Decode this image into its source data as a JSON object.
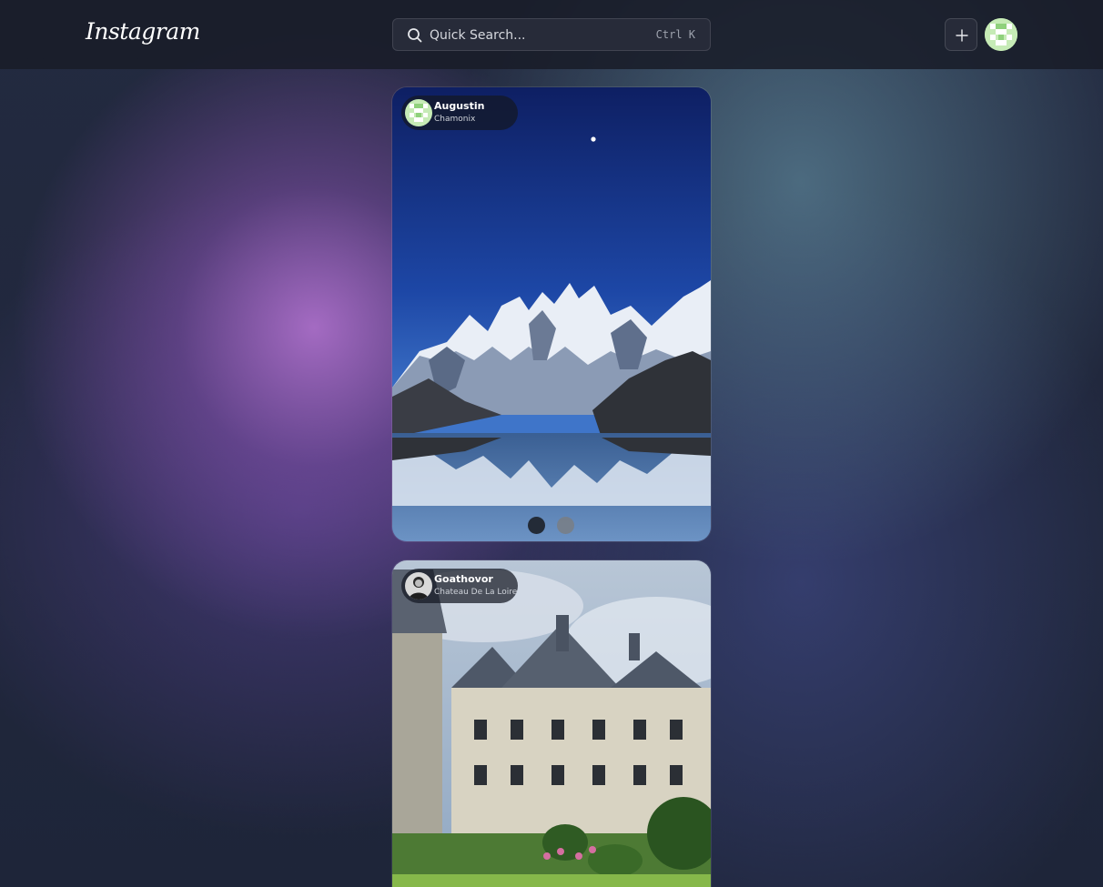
{
  "header": {
    "logo": "Instagram",
    "search": {
      "placeholder": "Quick Search...",
      "shortcut": "Ctrl K"
    },
    "new_post_icon": "plus-icon",
    "avatar_icon": "pixel-avatar"
  },
  "feed": {
    "posts": [
      {
        "username": "Augustin",
        "location": "Chamonix",
        "image": "snowy-mountains-lake-reflection",
        "carousel": {
          "count": 2,
          "active": 1
        }
      },
      {
        "username": "Goathovor",
        "location": "Chateau De La Loire",
        "image": "loire-chateau-garden"
      }
    ]
  },
  "colors": {
    "header_bg": "#181c28",
    "page_bg": "#1e2539",
    "accent_purple": "#a66ec8",
    "avatar_green": "#bfe8b0"
  }
}
